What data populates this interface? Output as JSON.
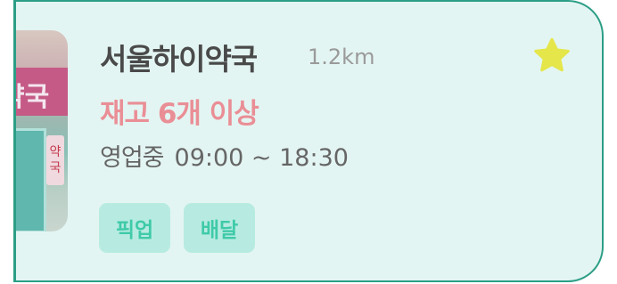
{
  "pharmacy": {
    "name": "서울하이약국",
    "distance": "1.2km",
    "stock_status": "재고 6개 이상",
    "business_status": "영업중",
    "hours": "09:00 ~ 18:30",
    "favorite_icon": "star-icon",
    "favorite": true,
    "tags": [
      "픽업",
      "배달"
    ]
  },
  "colors": {
    "card_bg": "#e3f5f2",
    "card_border": "#2c9e86",
    "stock_text": "#ea8e96",
    "tag_bg": "#b7ebe1",
    "tag_text": "#3fcaa8",
    "star": "#e4e64a"
  }
}
